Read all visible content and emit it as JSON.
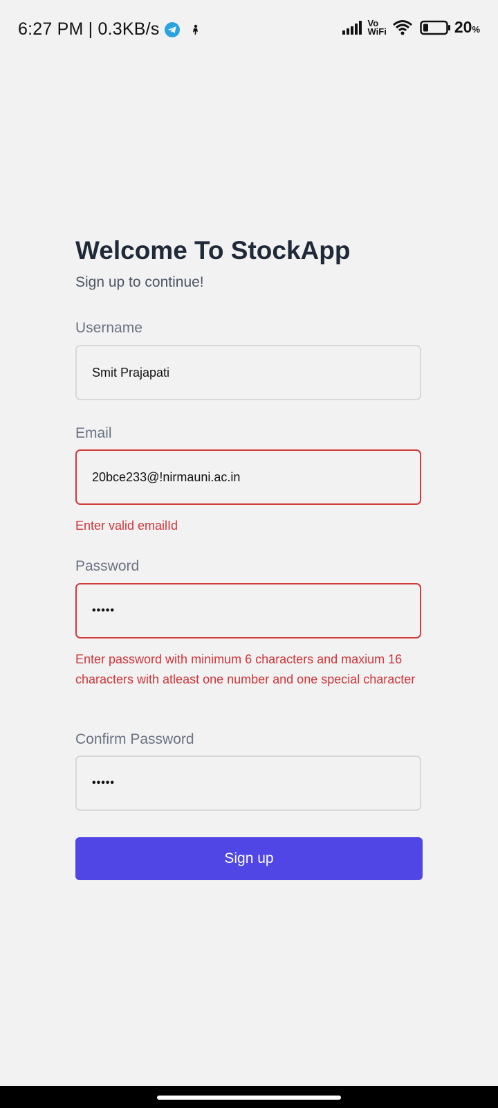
{
  "status_bar": {
    "time_speed": "6:27 PM | 0.3KB/s",
    "vo_top": "Vo",
    "vo_bottom": "WiFi",
    "battery": "20",
    "battery_unit": "%"
  },
  "form": {
    "title": "Welcome To StockApp",
    "subtitle": "Sign up to continue!",
    "username_label": "Username",
    "username_value": "Smit Prajapati",
    "email_label": "Email",
    "email_value": "20bce233@!nirmauni.ac.in",
    "email_error": "Enter valid emailId",
    "password_label": "Password",
    "password_value": "•••••",
    "password_error": "Enter password with minimum 6 characters and maxium 16 characters with atleast one number and one special character",
    "confirm_label": "Confirm Password",
    "confirm_value": "•••••",
    "signup_label": "Sign up"
  },
  "colors": {
    "background": "#f2f2f3",
    "accent": "#4f46e5",
    "error": "#d13438"
  },
  "icons": [
    "telegram-icon",
    "app-notification-icon",
    "signal-icon",
    "vowifi-icon",
    "wifi-icon",
    "battery-icon"
  ]
}
